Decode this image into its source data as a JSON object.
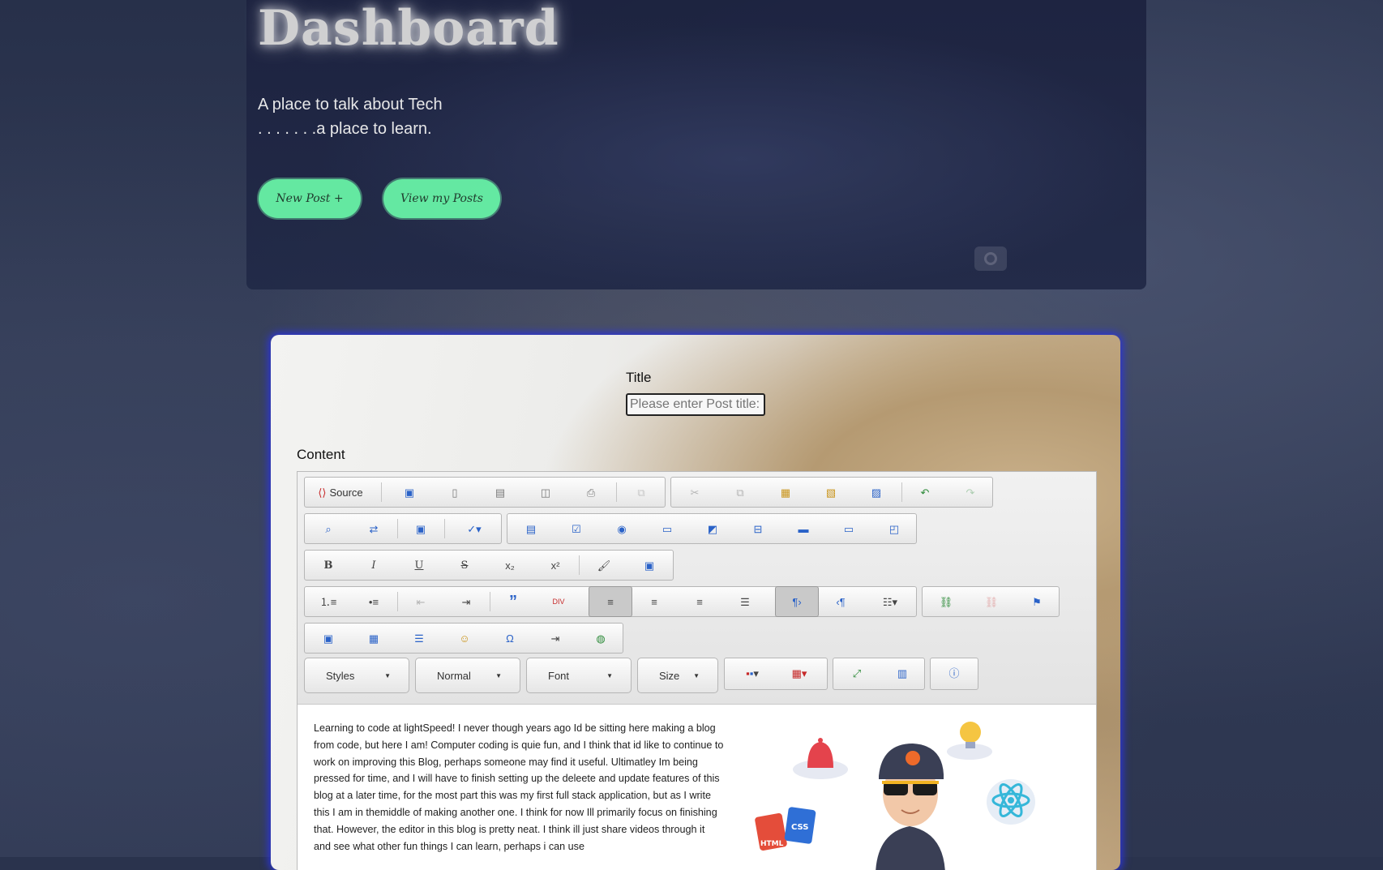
{
  "hero": {
    "title": "Dashboard",
    "tagline_line1": "A place to talk about Tech",
    "tagline_line2": ". . . . . . .a place to learn.",
    "new_post_label": "New Post +",
    "view_posts_label": "View my Posts"
  },
  "form": {
    "title_label": "Title",
    "title_placeholder": "Please enter Post title:",
    "content_label": "Content"
  },
  "editor": {
    "source_label": "Source",
    "styles_label": "Styles",
    "format_label": "Normal",
    "font_label": "Font",
    "size_label": "Size",
    "body_text": "Learning to code at lightSpeed! I never though years ago Id be sitting here making a blog from code, but here I am! Computer coding is quie fun, and I think that id like to continue to work on improving this Blog, perhaps someone may find it useful. Ultimatley Im being pressed for time, and I will have to finish setting up the deleete and update features of this blog at a later time, for the most part this was my first full stack application, but as I write this I am in themiddle of making another one. I think for now Ill primarily focus on finishing that. However, the editor in this blog is pretty neat. I think ill just share videos through it and see what other fun things I can learn, perhaps i can use",
    "illustration_html_label": "HTML",
    "illustration_css_label": "CSS"
  },
  "colors": {
    "pill_green": "#67f2a6",
    "card_glow": "#2c35d6"
  }
}
